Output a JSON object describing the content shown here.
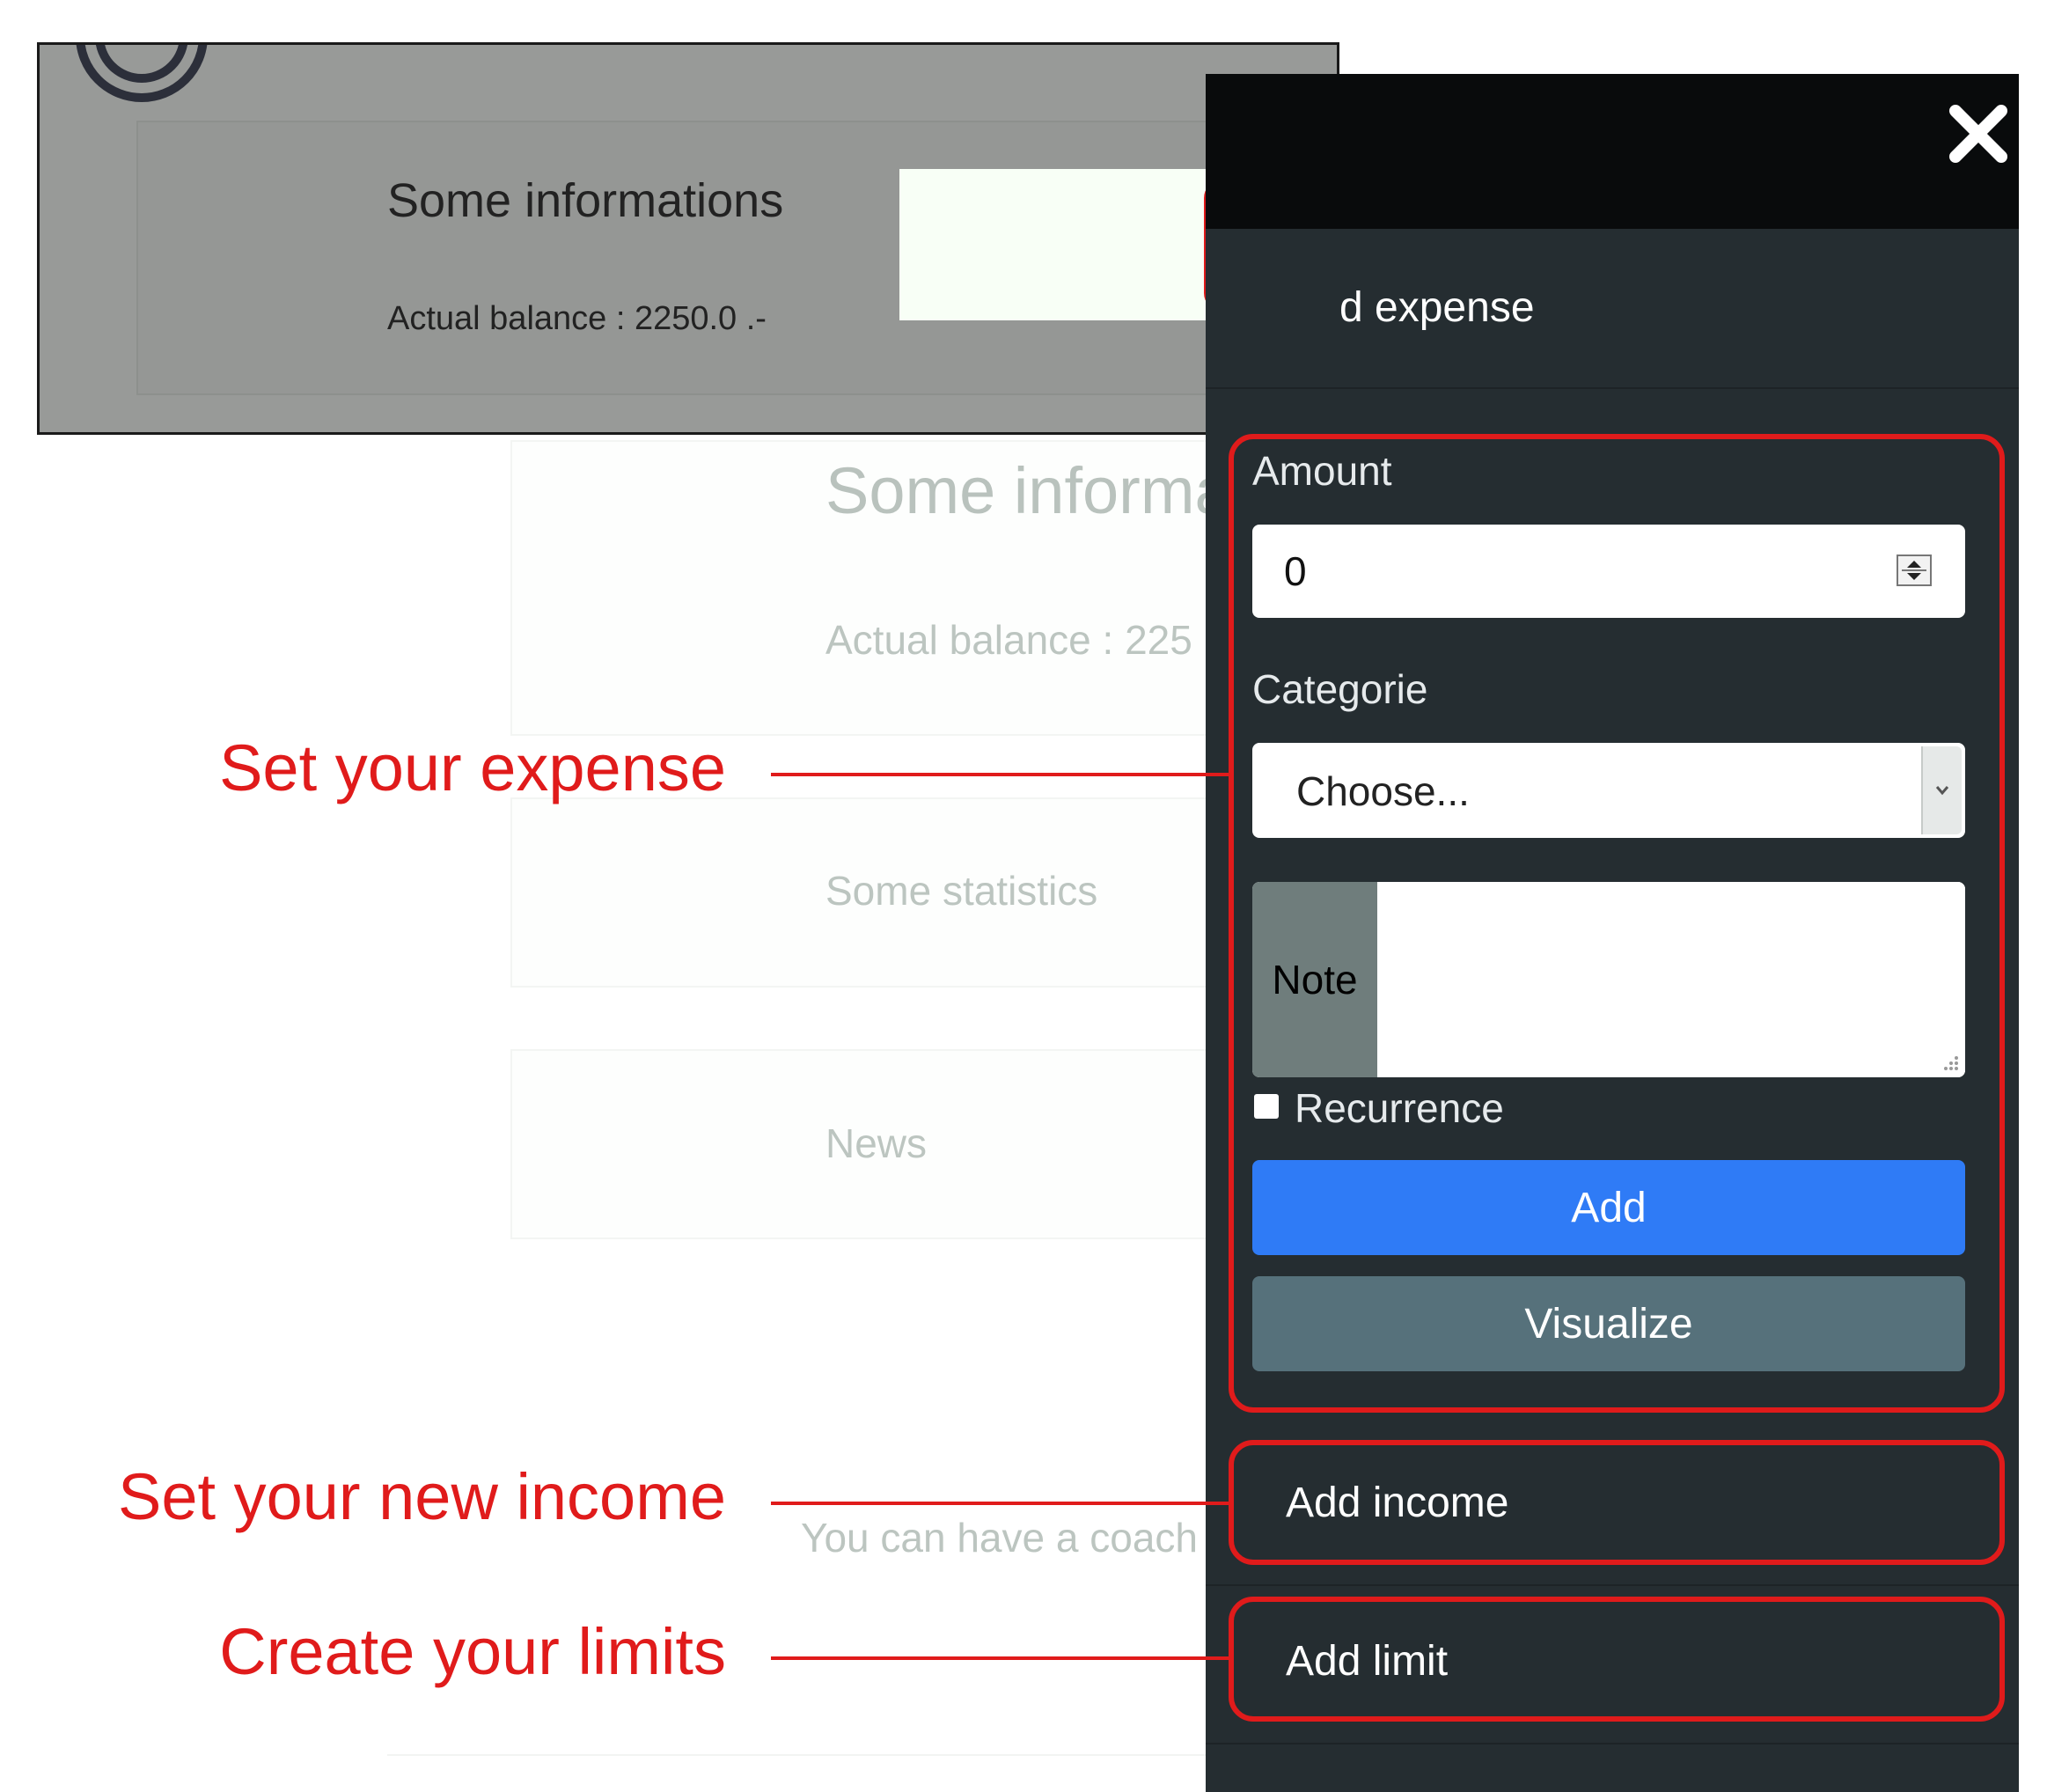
{
  "background_page": {
    "info_title": "Some informa",
    "balance_text": "Actual balance : 225",
    "statistics_text": "Some statistics",
    "news_text": "News",
    "coach_text": "You can have a coach"
  },
  "inset": {
    "title": "Some informations",
    "balance": "Actual balance : 2250.0 .-"
  },
  "sidebar": {
    "section_title": "d expense",
    "amount_label": "Amount",
    "amount_value": "0",
    "categorie_label": "Categorie",
    "categorie_selected": "Choose...",
    "note_label": "Note",
    "note_value": "",
    "recurrence_label": "Recurrence",
    "recurrence_checked": false,
    "add_button": "Add",
    "visualize_button": "Visualize",
    "add_income": "Add income",
    "add_limit": "Add limit"
  },
  "annotations": {
    "expense": "Set your expense",
    "income": "Set your new income",
    "limits": "Create your limits"
  },
  "colors": {
    "annotation_red": "#e01b1b",
    "sidebar_bg": "#252d31",
    "sidebar_top": "#090b0c",
    "primary_button": "#2f7bf6",
    "secondary_button": "#56717b"
  },
  "icons": [
    "close-icon",
    "plus-circle-icon",
    "spinner-icon",
    "chevron-down-icon",
    "resize-grip-icon",
    "logo-icon"
  ]
}
